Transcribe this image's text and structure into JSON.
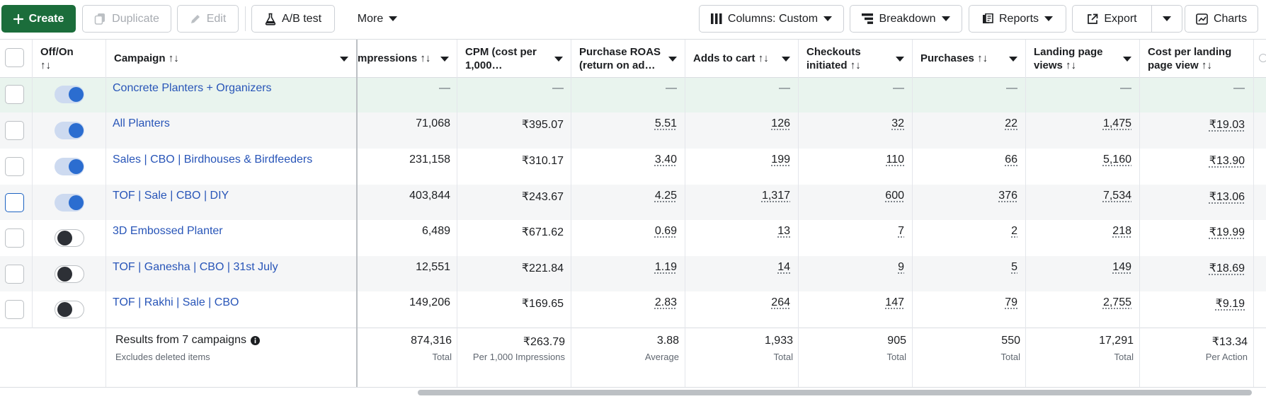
{
  "toolbar": {
    "create": "Create",
    "duplicate": "Duplicate",
    "edit": "Edit",
    "ab_test": "A/B test",
    "more": "More",
    "columns": "Columns: Custom",
    "breakdown": "Breakdown",
    "reports": "Reports",
    "export": "Export",
    "charts": "Charts"
  },
  "headers": {
    "off_on": "Off/On",
    "campaign": "Campaign",
    "impressions": "mpressions",
    "cpm": "CPM (cost per 1,000…",
    "roas": "Purchase ROAS (return on ad…",
    "adds_to_cart": "Adds to cart",
    "checkouts": "Checkouts initiated",
    "purchases": "Purchases",
    "landing_views": "Landing page views",
    "cost_landing": "Cost per landing page view",
    "sort_glyph": "↑↓"
  },
  "rows": [
    {
      "name": "Concrete Planters + Organizers",
      "on": true,
      "impressions": "—",
      "cpm": "—",
      "roas": "—",
      "adds": "—",
      "checkouts": "—",
      "purchases": "—",
      "lpv": "—",
      "cplpv": "—"
    },
    {
      "name": "All Planters",
      "on": true,
      "impressions": "71,068",
      "cpm": "₹395.07",
      "roas": "5.51",
      "adds": "126",
      "checkouts": "32",
      "purchases": "22",
      "lpv": "1,475",
      "cplpv": "₹19.03"
    },
    {
      "name": "Sales | CBO | Birdhouses & Birdfeeders",
      "on": true,
      "impressions": "231,158",
      "cpm": "₹310.17",
      "roas": "3.40",
      "adds": "199",
      "checkouts": "110",
      "purchases": "66",
      "lpv": "5,160",
      "cplpv": "₹13.90"
    },
    {
      "name": "TOF | Sale | CBO | DIY",
      "on": true,
      "impressions": "403,844",
      "cpm": "₹243.67",
      "roas": "4.25",
      "adds": "1,317",
      "checkouts": "600",
      "purchases": "376",
      "lpv": "7,534",
      "cplpv": "₹13.06"
    },
    {
      "name": "3D Embossed Planter",
      "on": false,
      "impressions": "6,489",
      "cpm": "₹671.62",
      "roas": "0.69",
      "adds": "13",
      "checkouts": "7",
      "purchases": "2",
      "lpv": "218",
      "cplpv": "₹19.99"
    },
    {
      "name": "TOF | Ganesha | CBO | 31st July",
      "on": false,
      "impressions": "12,551",
      "cpm": "₹221.84",
      "roas": "1.19",
      "adds": "14",
      "checkouts": "9",
      "purchases": "5",
      "lpv": "149",
      "cplpv": "₹18.69"
    },
    {
      "name": "TOF | Rakhi | Sale | CBO",
      "on": false,
      "impressions": "149,206",
      "cpm": "₹169.65",
      "roas": "2.83",
      "adds": "264",
      "checkouts": "147",
      "purchases": "79",
      "lpv": "2,755",
      "cplpv": "₹9.19"
    }
  ],
  "totals": {
    "label": "Results from 7 campaigns",
    "sublabel": "Excludes deleted items",
    "impressions": "874,316",
    "impressions_sub": "Total",
    "cpm": "₹263.79",
    "cpm_sub": "Per 1,000 Impressions",
    "roas": "3.88",
    "roas_sub": "Average",
    "adds": "1,933",
    "adds_sub": "Total",
    "checkouts": "905",
    "checkouts_sub": "Total",
    "purchases": "550",
    "purchases_sub": "Total",
    "lpv": "17,291",
    "lpv_sub": "Total",
    "cplpv": "₹13.34",
    "cplpv_sub": "Per Action"
  },
  "colors": {
    "primary": "#1b6d3b",
    "link": "#2855b8",
    "toggle_on": "#2b6dd0",
    "row_highlight": "#e9f4ee",
    "row_alt": "#f5f6f7"
  }
}
